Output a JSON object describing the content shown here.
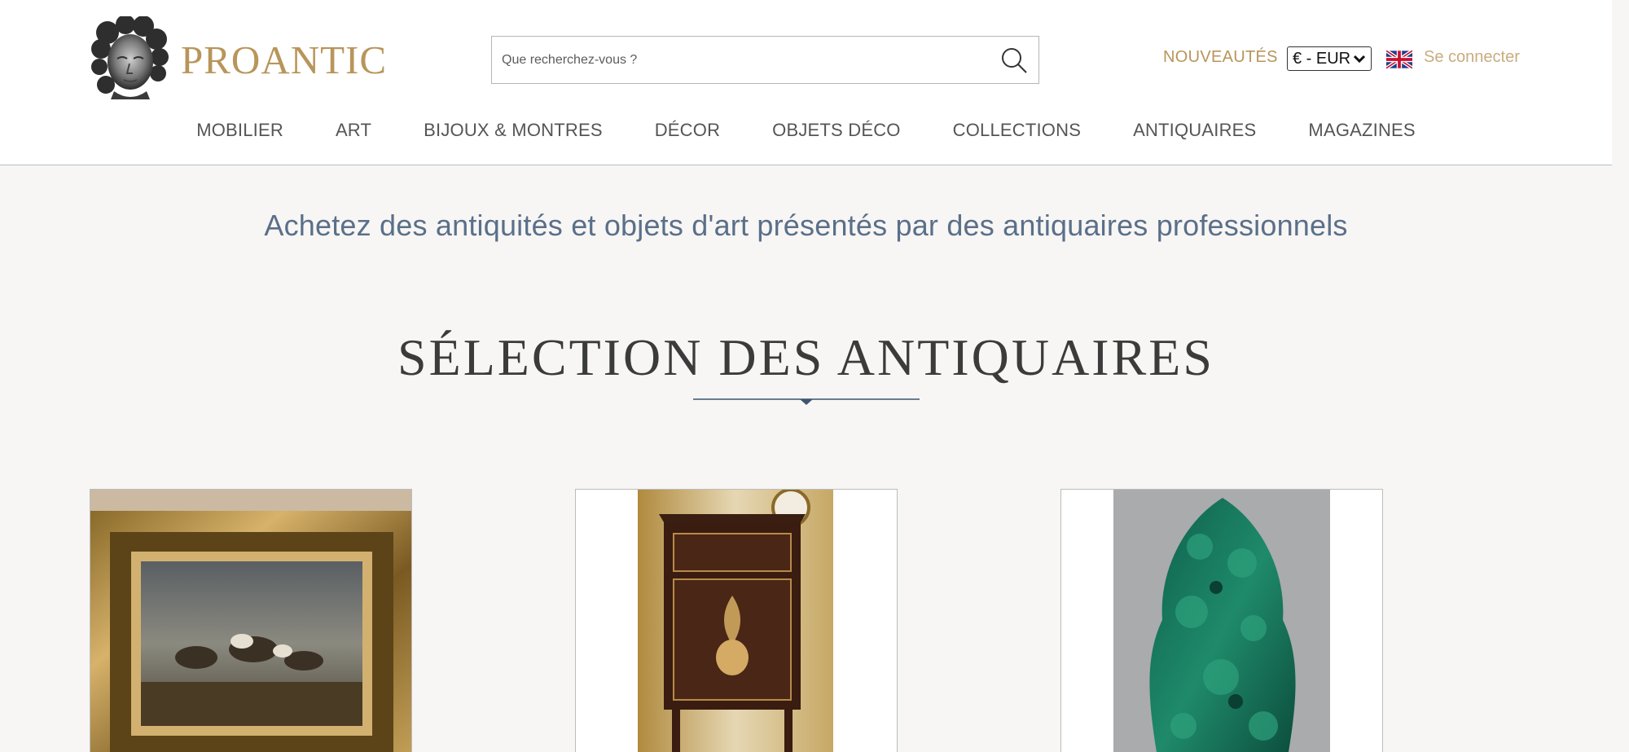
{
  "brand": {
    "name": "PROANTIC",
    "color": "#b8955a"
  },
  "search": {
    "placeholder": "Que recherchez-vous ?"
  },
  "header": {
    "nouveautes_label": "NOUVEAUTÉS",
    "currency_selected": "€ - EUR",
    "language_flag": "uk-flag-icon",
    "login_label": "Se connecter"
  },
  "nav": {
    "items": [
      {
        "label": "MOBILIER"
      },
      {
        "label": "ART"
      },
      {
        "label": "BIJOUX & MONTRES"
      },
      {
        "label": "DÉCOR"
      },
      {
        "label": "OBJETS DÉCO"
      },
      {
        "label": "COLLECTIONS"
      },
      {
        "label": "ANTIQUAIRES"
      },
      {
        "label": "MAGAZINES"
      }
    ]
  },
  "hero": {
    "tagline": "Achetez des antiquités et objets d'art présentés par des antiquaires professionnels",
    "section_title": "SÉLECTION DES ANTIQUAIRES"
  },
  "products": [
    {
      "image": "gilt-framed-battle-painting"
    },
    {
      "image": "marquetry-bedside-cabinet"
    },
    {
      "image": "malachite-tree-sculpture"
    }
  ],
  "colors": {
    "accent_gold": "#b8955a",
    "tagline_blue": "#5a6f89",
    "background": "#f7f6f4"
  }
}
